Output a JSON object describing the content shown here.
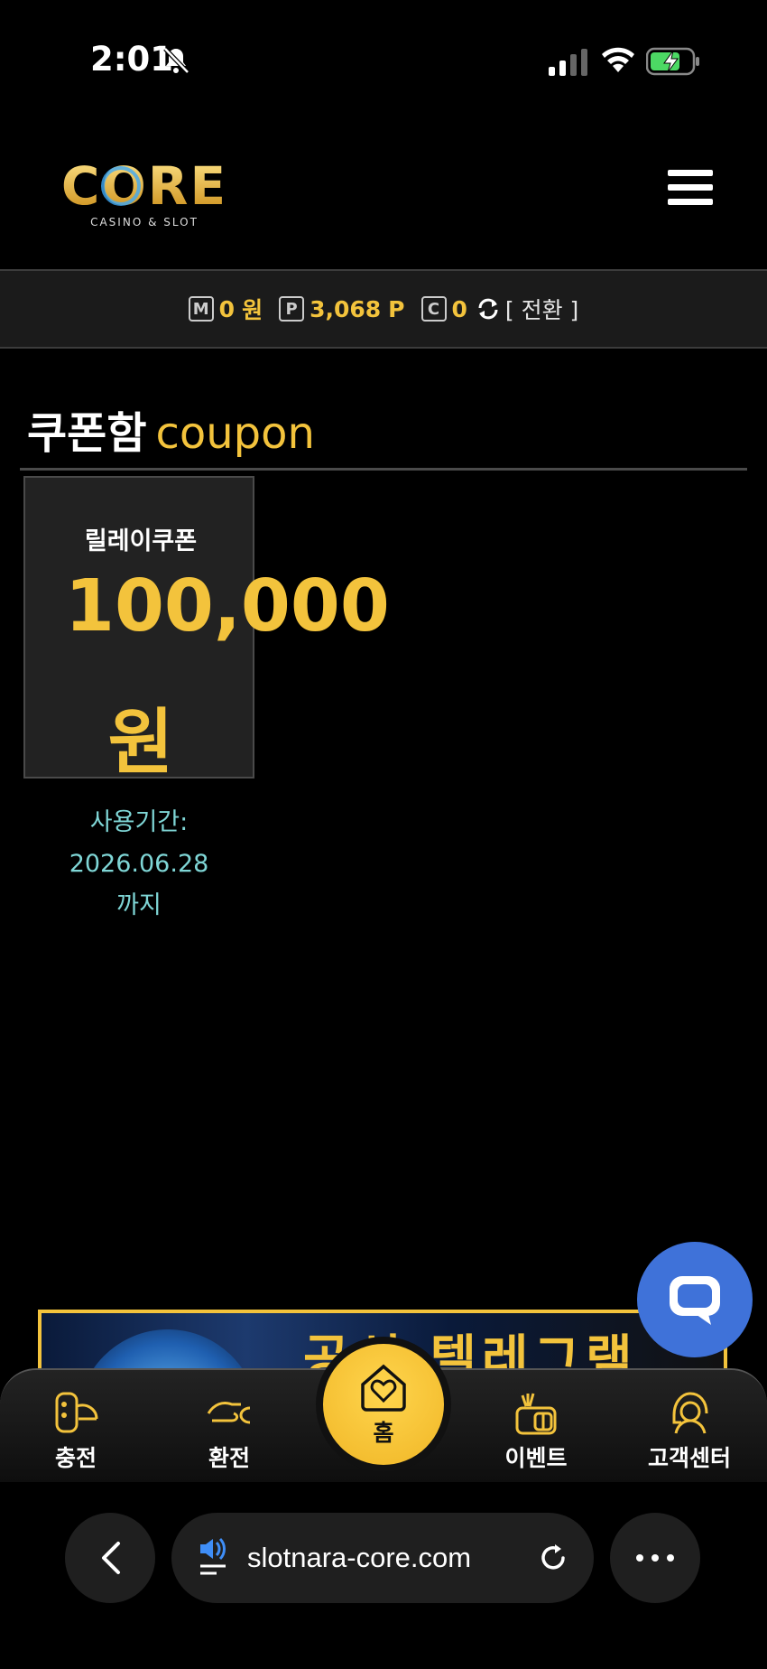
{
  "status_bar": {
    "time": "2:01"
  },
  "header": {
    "logo_text": "CORE",
    "logo_subtext": "CASINO & SLOT"
  },
  "balance": {
    "money_icon": "M",
    "money_value": "0",
    "money_unit": "원",
    "point_icon": "P",
    "point_value": "3,068",
    "point_unit": "P",
    "coin_icon": "C",
    "coin_value": "0",
    "switch_label": "[ 전환 ]"
  },
  "page": {
    "title_ko": "쿠폰함",
    "title_en": "coupon"
  },
  "coupons": [
    {
      "name": "릴레이쿠폰",
      "amount": "100,000",
      "unit": "원",
      "expiry_label": "사용기간:",
      "expiry_date": "2026.06.28",
      "expiry_suffix": "까지"
    }
  ],
  "banner": {
    "text": "공식 텔레그램"
  },
  "bottom_nav": {
    "charge": "충전",
    "exchange": "환전",
    "home": "홈",
    "event": "이벤트",
    "support": "고객센터"
  },
  "browser": {
    "url": "slotnara-core.com"
  },
  "colors": {
    "accent": "#f3c33c",
    "expiry": "#7fd6d6",
    "chat": "#3f72d9"
  },
  "icons": [
    "bell-slash-icon",
    "signal-icon",
    "wifi-icon",
    "battery-charging-icon",
    "hamburger-menu-icon",
    "refresh-icon",
    "chat-icon",
    "charge-icon",
    "exchange-icon",
    "home-heart-icon",
    "gift-icon",
    "support-headset-icon",
    "back-icon",
    "speaker-icon",
    "reload-icon",
    "more-icon"
  ]
}
